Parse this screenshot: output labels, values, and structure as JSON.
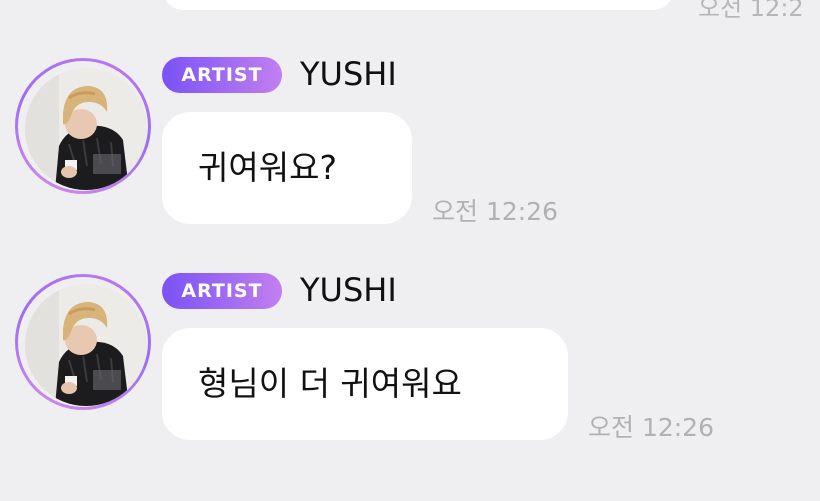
{
  "previous_message": {
    "time_fragment": "오전 12:2"
  },
  "messages": [
    {
      "badge": "ARTIST",
      "sender": "YUSHI",
      "text": "귀여워요?",
      "time": "오전 12:26"
    },
    {
      "badge": "ARTIST",
      "sender": "YUSHI",
      "text": "형님이 더 귀여워요",
      "time": "오전 12:26"
    }
  ],
  "colors": {
    "background": "#efeff1",
    "bubble": "#ffffff",
    "badge_start": "#7a53f6",
    "badge_end": "#c27ff0",
    "avatar_ring": "#b57af2",
    "timestamp": "#b1b1b4"
  }
}
